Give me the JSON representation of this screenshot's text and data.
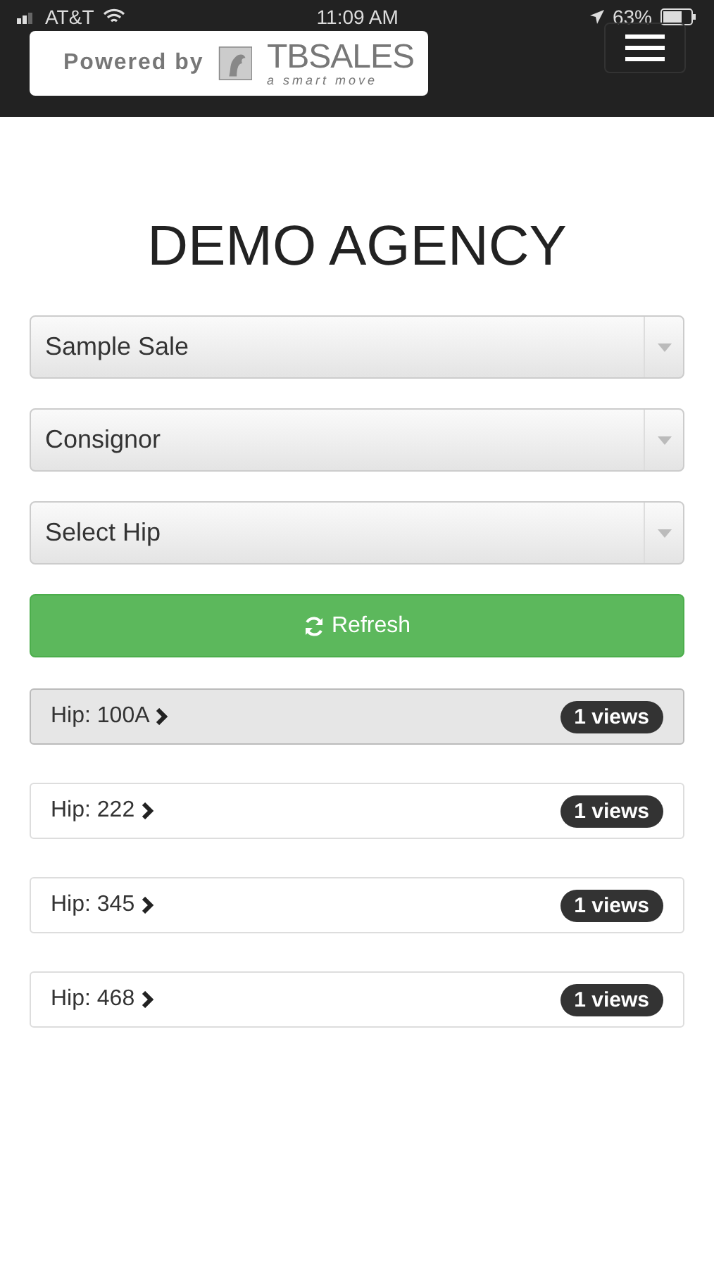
{
  "status_bar": {
    "carrier": "AT&T",
    "time": "11:09 AM",
    "battery": "63%"
  },
  "header": {
    "powered_by": "Powered by",
    "logo_name": "TBSALES",
    "logo_tagline": "a smart move"
  },
  "title": "DEMO AGENCY",
  "selects": [
    {
      "value": "Sample Sale"
    },
    {
      "value": "Consignor"
    },
    {
      "value": "Select Hip"
    }
  ],
  "refresh_button": "Refresh",
  "hips": [
    {
      "label": "Hip: 100A",
      "views": "1 views",
      "selected": true
    },
    {
      "label": "Hip: 222",
      "views": "1 views",
      "selected": false
    },
    {
      "label": "Hip: 345",
      "views": "1 views",
      "selected": false
    },
    {
      "label": "Hip: 468",
      "views": "1 views",
      "selected": false
    }
  ]
}
